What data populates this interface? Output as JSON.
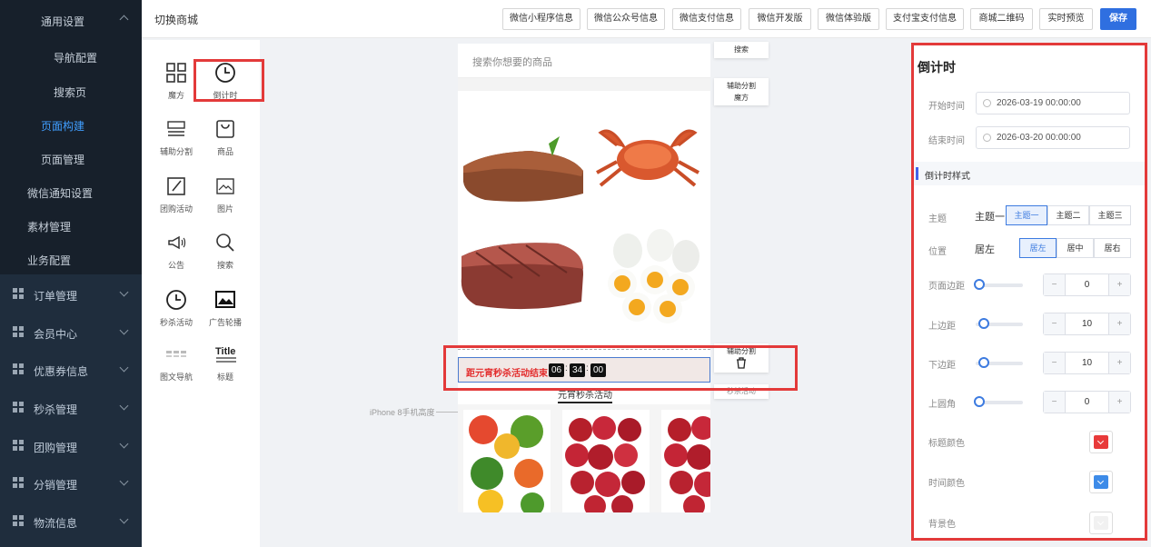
{
  "sidebar": {
    "sub_items": [
      "通用设置",
      "导航配置",
      "搜索页",
      "页面构建",
      "页面管理",
      "微信通知设置",
      "素材管理",
      "业务配置"
    ],
    "groups": [
      "订单管理",
      "会员中心",
      "优惠券信息",
      "秒杀管理",
      "团购管理",
      "分销管理",
      "物流信息"
    ]
  },
  "topbar": {
    "title": "切换商城",
    "buttons": [
      "微信小程序信息",
      "微信公众号信息",
      "微信支付信息",
      "微信开发版",
      "微信体验版",
      "支付宝支付信息",
      "商城二维码",
      "实时预览",
      "保存"
    ]
  },
  "palette": [
    "魔方",
    "倒计时",
    "辅助分割",
    "商品",
    "团购活动",
    "图片",
    "公告",
    "搜索",
    "秒杀活动",
    "广告轮播",
    "图文导航",
    "标题"
  ],
  "phone": {
    "search_placeholder": "搜索你想要的商品",
    "countdown_text": "距元宵秒杀活动结束",
    "countdown_hours": "06",
    "countdown_minutes": "34",
    "countdown_seconds": "00",
    "sep": ":",
    "tab_label": "元宵秒杀活动",
    "iphone_label": "iPhone 8手机高度"
  },
  "side_tags": {
    "search": "搜索",
    "divider": "辅助分割",
    "cube": "魔方",
    "divider2": "辅助分割",
    "seckill": "秒杀活动"
  },
  "props": {
    "title": "倒计时",
    "start_label": "开始时间",
    "start_value": "2026-03-19 00:00:00",
    "end_label": "结束时间",
    "end_value": "2026-03-20 00:00:00",
    "style_section": "倒计时样式",
    "theme_label": "主题",
    "theme_current": "主题一",
    "themes": [
      "主题一",
      "主题二",
      "主题三"
    ],
    "position_label": "位置",
    "position_current": "居左",
    "positions": [
      "居左",
      "居中",
      "居右"
    ],
    "page_margin_label": "页面边距",
    "page_margin": "0",
    "top_margin_label": "上边距",
    "top_margin": "10",
    "bottom_margin_label": "下边距",
    "bottom_margin": "10",
    "radius_label": "上圆角",
    "radius": "0",
    "title_color_label": "标题颜色",
    "title_color": "#e83a3a",
    "time_color_label": "时间颜色",
    "time_color": "#3d8be8",
    "bg_color_label": "背景色",
    "bg_color": "#f1f1f1"
  },
  "colors": {
    "accent": "#2f6fe0",
    "highlight": "#e33a3a",
    "sidebar": "#1f2d3d",
    "active_menu": "#409eff"
  }
}
